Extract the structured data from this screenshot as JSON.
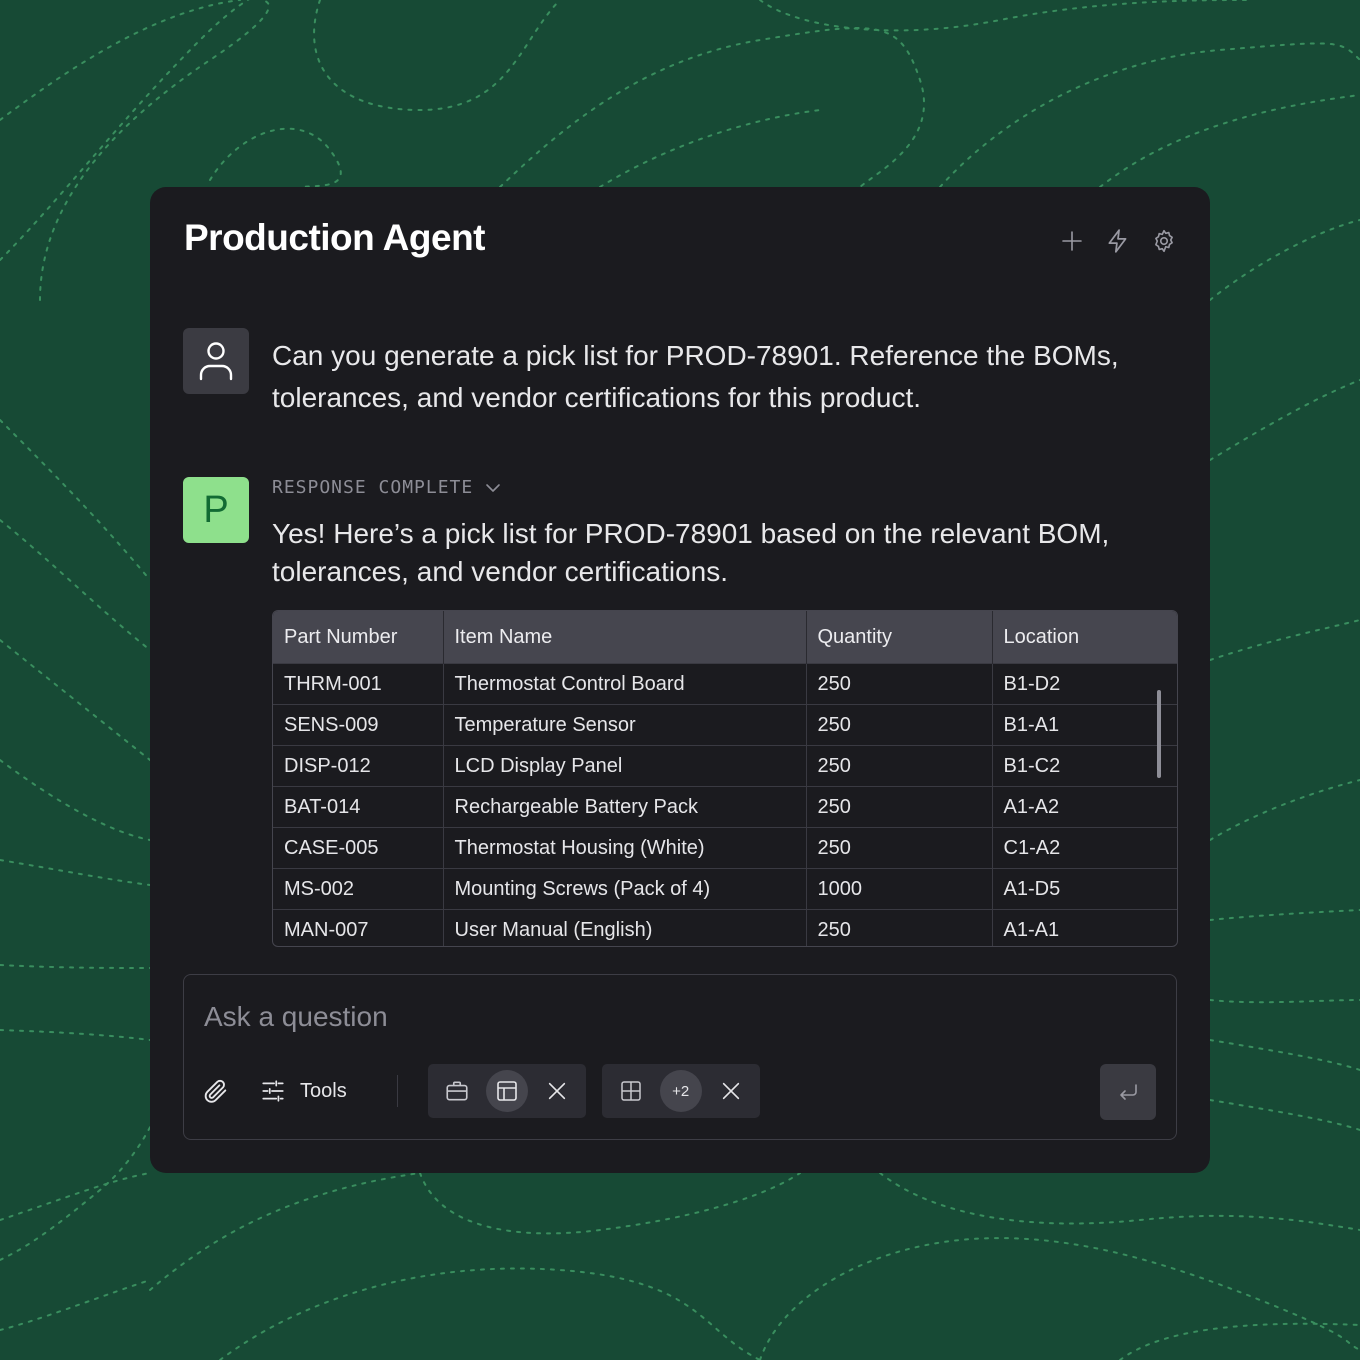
{
  "app": {
    "title": "Production Agent"
  },
  "header_icons": [
    "plus-icon",
    "bolt-icon",
    "gear-icon"
  ],
  "user_message": {
    "text": "Can you generate a pick list for PROD-78901. Reference the BOMs, tolerances, and vendor certifications for this product."
  },
  "agent": {
    "avatar_letter": "P",
    "status": "RESPONSE COMPLETE",
    "message": "Yes! Here’s a pick list for PROD-78901 based on the relevant BOM, tolerances, and vendor certifications."
  },
  "pick_list": {
    "columns": [
      "Part Number",
      "Item Name",
      "Quantity",
      "Location"
    ],
    "rows": [
      [
        "THRM-001",
        "Thermostat Control Board",
        "250",
        "B1-D2"
      ],
      [
        "SENS-009",
        "Temperature Sensor",
        "250",
        "B1-A1"
      ],
      [
        "DISP-012",
        "LCD Display Panel",
        "250",
        "B1-C2"
      ],
      [
        "BAT-014",
        "Rechargeable Battery Pack",
        "250",
        "A1-A2"
      ],
      [
        "CASE-005",
        "Thermostat Housing (White)",
        "250",
        "C1-A2"
      ],
      [
        "MS-002",
        "Mounting Screws (Pack of 4)",
        "1000",
        "A1-D5"
      ],
      [
        "MAN-007",
        "User Manual (English)",
        "250",
        "A1-A1"
      ]
    ]
  },
  "composer": {
    "placeholder": "Ask a question",
    "value": "",
    "tools_label": "Tools",
    "extra_count": "+2"
  },
  "colors": {
    "background": "#174a35",
    "panel": "#1b1b1f",
    "agent_avatar": "#8ee08c",
    "table_header": "#46464f"
  }
}
